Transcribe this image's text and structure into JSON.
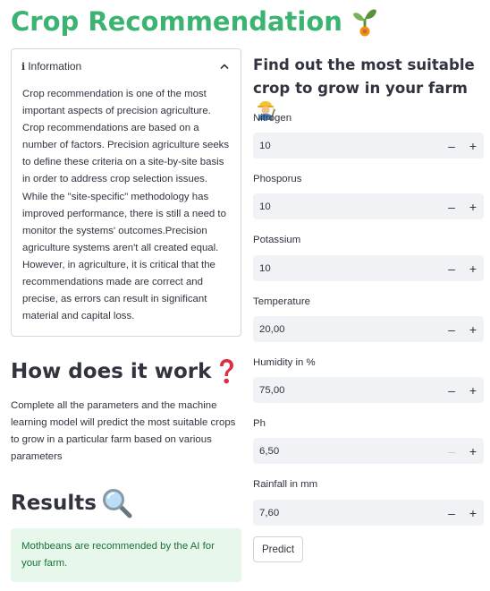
{
  "header": {
    "title": "Crop Recommendation",
    "title_icon": "seedling-icon"
  },
  "info": {
    "expander_label": "Information",
    "body": "Crop recommendation is one of the most important aspects of precision agriculture. Crop recommendations are based on a number of factors. Precision agriculture seeks to define these criteria on a site-by-site basis in order to address crop selection issues. While the \"site-specific\" methodology has improved performance, there is still a need to monitor the systems' outcomes.Precision agriculture systems aren't all created equal. However, in agriculture, it is critical that the recommendations made are correct and precise, as errors can result in significant material and capital loss.",
    "expanded": true
  },
  "how": {
    "heading": "How does it work",
    "icon": "red-question-mark-icon",
    "text": "Complete all the parameters and the machine learning model will predict the most suitable crops to grow in a particular farm based on various parameters"
  },
  "results": {
    "heading": "Results",
    "icon": "magnifying-glass-icon",
    "message": "Mothbeans are recommended by the AI for your farm."
  },
  "form": {
    "heading": "Find out the most suitable crop to grow in your farm",
    "heading_icon": "farmer-icon",
    "fields": [
      {
        "label": "Nitrogen",
        "value": "10",
        "minus": "–",
        "plus": "+"
      },
      {
        "label": "Phosporus",
        "value": "10",
        "minus": "–",
        "plus": "+"
      },
      {
        "label": "Potassium",
        "value": "10",
        "minus": "–",
        "plus": "+"
      },
      {
        "label": "Temperature",
        "value": "20,00",
        "minus": "–",
        "plus": "+"
      },
      {
        "label": "Humidity in %",
        "value": "75,00",
        "minus": "–",
        "plus": "+"
      },
      {
        "label": "Ph",
        "value": "6,50",
        "minus": "–",
        "plus": "+",
        "minus_disabled": true
      },
      {
        "label": "Rainfall in mm",
        "value": "7,60",
        "minus": "–",
        "plus": "+"
      }
    ],
    "submit_label": "Predict"
  },
  "colors": {
    "title": "#3cb371",
    "success_bg": "#e8f7ec",
    "success_text": "#177233",
    "input_bg": "#f0f2f6",
    "text": "#31333f"
  }
}
